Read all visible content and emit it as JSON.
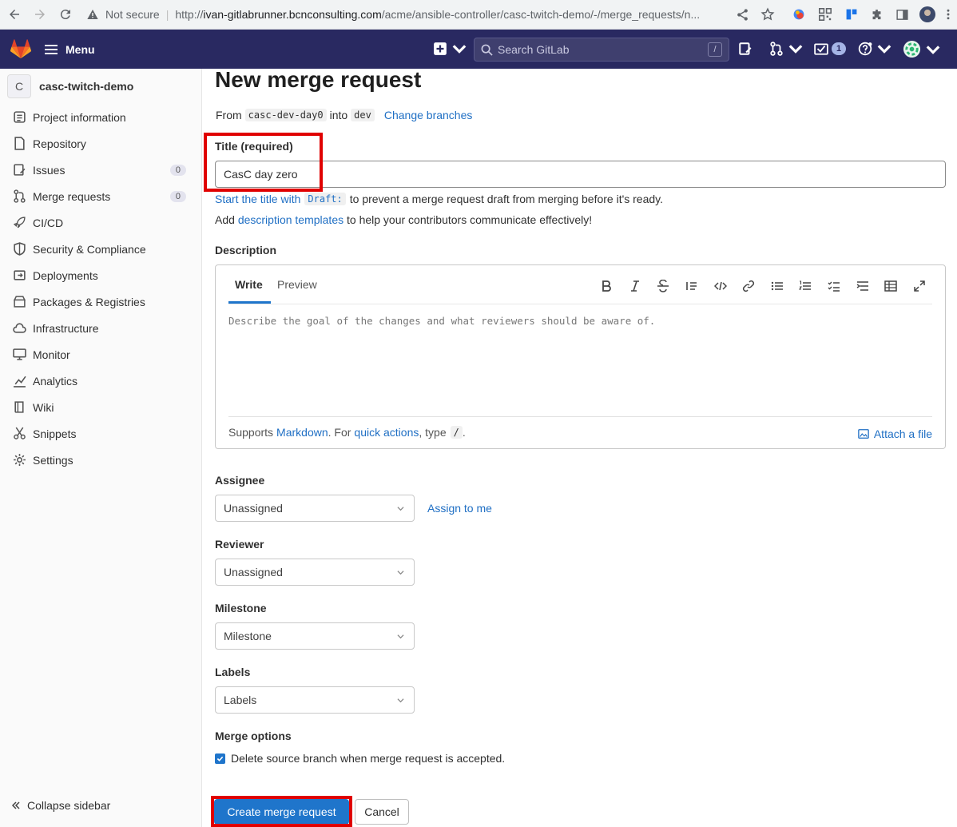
{
  "browser": {
    "not_secure": "Not secure",
    "url_prefix": "http://",
    "url_host": "ivan-gitlabrunner.bcnconsulting.com",
    "url_path": "/acme/ansible-controller/casc-twitch-demo/-/merge_requests/n..."
  },
  "topbar": {
    "menu_label": "Menu",
    "search_placeholder": "Search GitLab",
    "search_shortcut": "/",
    "todo_count": "1"
  },
  "sidebar": {
    "project_initial": "C",
    "project_name": "casc-twitch-demo",
    "items": [
      {
        "label": "Project information",
        "icon": "project-icon"
      },
      {
        "label": "Repository",
        "icon": "doc-icon"
      },
      {
        "label": "Issues",
        "icon": "issues-icon",
        "count": "0"
      },
      {
        "label": "Merge requests",
        "icon": "merge-request-icon",
        "count": "0"
      },
      {
        "label": "CI/CD",
        "icon": "rocket-icon"
      },
      {
        "label": "Security & Compliance",
        "icon": "shield-icon"
      },
      {
        "label": "Deployments",
        "icon": "deployments-icon"
      },
      {
        "label": "Packages & Registries",
        "icon": "package-icon"
      },
      {
        "label": "Infrastructure",
        "icon": "cloud-icon"
      },
      {
        "label": "Monitor",
        "icon": "monitor-icon"
      },
      {
        "label": "Analytics",
        "icon": "chart-icon"
      },
      {
        "label": "Wiki",
        "icon": "book-icon"
      },
      {
        "label": "Snippets",
        "icon": "snippet-icon"
      },
      {
        "label": "Settings",
        "icon": "gear-icon"
      }
    ],
    "collapse_label": "Collapse sidebar"
  },
  "page": {
    "title": "New merge request",
    "from_label": "From",
    "source_branch": "casc-dev-day0",
    "into_label": "into",
    "target_branch": "dev",
    "change_branches": "Change branches",
    "title_label": "Title (required)",
    "title_value": "CasC day zero",
    "draft_hint_link": "Start the title with",
    "draft_code": "Draft:",
    "draft_hint_rest": "to prevent a merge request draft from merging before it's ready.",
    "templates_prefix": "Add",
    "templates_link": "description templates",
    "templates_rest": "to help your contributors communicate effectively!",
    "description_label": "Description",
    "tab_write": "Write",
    "tab_preview": "Preview",
    "description_placeholder": "Describe the goal of the changes and what reviewers should be aware of.",
    "supports": "Supports",
    "markdown_link": "Markdown",
    "for_text": ". For",
    "quick_actions_link": "quick actions",
    "type_text": ", type",
    "slash": "/",
    "period": ".",
    "attach_file": "Attach a file",
    "assignee_label": "Assignee",
    "assignee_value": "Unassigned",
    "assign_to_me": "Assign to me",
    "reviewer_label": "Reviewer",
    "reviewer_value": "Unassigned",
    "milestone_label": "Milestone",
    "milestone_value": "Milestone",
    "labels_label": "Labels",
    "labels_value": "Labels",
    "merge_options_label": "Merge options",
    "delete_branch_label": "Delete source branch when merge request is accepted.",
    "delete_branch_checked": true,
    "create_button": "Create merge request",
    "cancel_button": "Cancel"
  },
  "colors": {
    "topbar": "#292961",
    "link": "#1f6fc4",
    "primary_button": "#1f75cb",
    "highlight": "#e00000"
  }
}
